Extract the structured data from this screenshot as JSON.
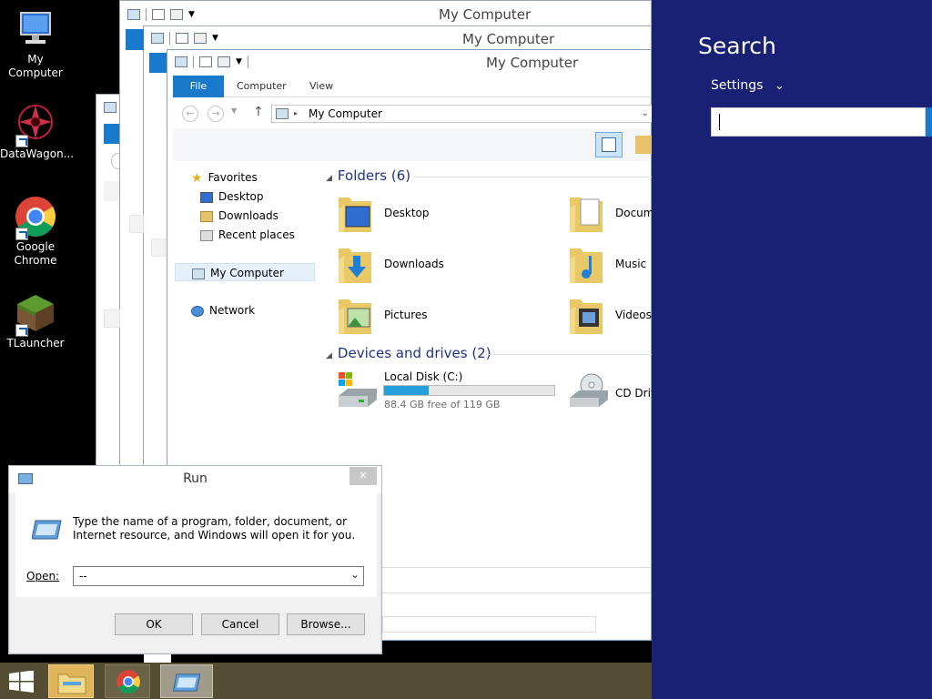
{
  "desktop": {
    "icons": [
      {
        "label": "My Computer"
      },
      {
        "label": "DataWagon..."
      },
      {
        "label": "Google Chrome"
      },
      {
        "label": "TLauncher"
      }
    ]
  },
  "explorer": {
    "title": "My Computer",
    "tabs": {
      "file": "File",
      "computer": "Computer",
      "view": "View"
    },
    "address": "My Computer",
    "nav": {
      "favorites": "Favorites",
      "desktop": "Desktop",
      "downloads": "Downloads",
      "recent": "Recent places",
      "computer": "My Computer",
      "network": "Network"
    },
    "folders_header": "Folders (6)",
    "folders": {
      "desktop": "Desktop",
      "documents": "Docum",
      "downloads": "Downloads",
      "music": "Music",
      "pictures": "Pictures",
      "videos": "Videos"
    },
    "devices_header": "Devices and drives (2)",
    "drive_c": {
      "name": "Local Disk (C:)",
      "free": "88.4 GB free of 119 GB",
      "used_fraction": 0.26
    },
    "drive_cd": {
      "name": "CD Driv"
    }
  },
  "run": {
    "title": "Run",
    "close": "✕",
    "description": "Type the name of a program, folder, document, or Internet resource, and Windows will open it for you.",
    "open_label": "Open:",
    "open_value": "--",
    "ok": "OK",
    "cancel": "Cancel",
    "browse": "Browse..."
  },
  "charm": {
    "title": "Search",
    "scope": "Settings",
    "input_value": ""
  },
  "colors": {
    "accent": "#1979ca",
    "charm_bg": "#182173",
    "taskbar": "#544d34"
  }
}
